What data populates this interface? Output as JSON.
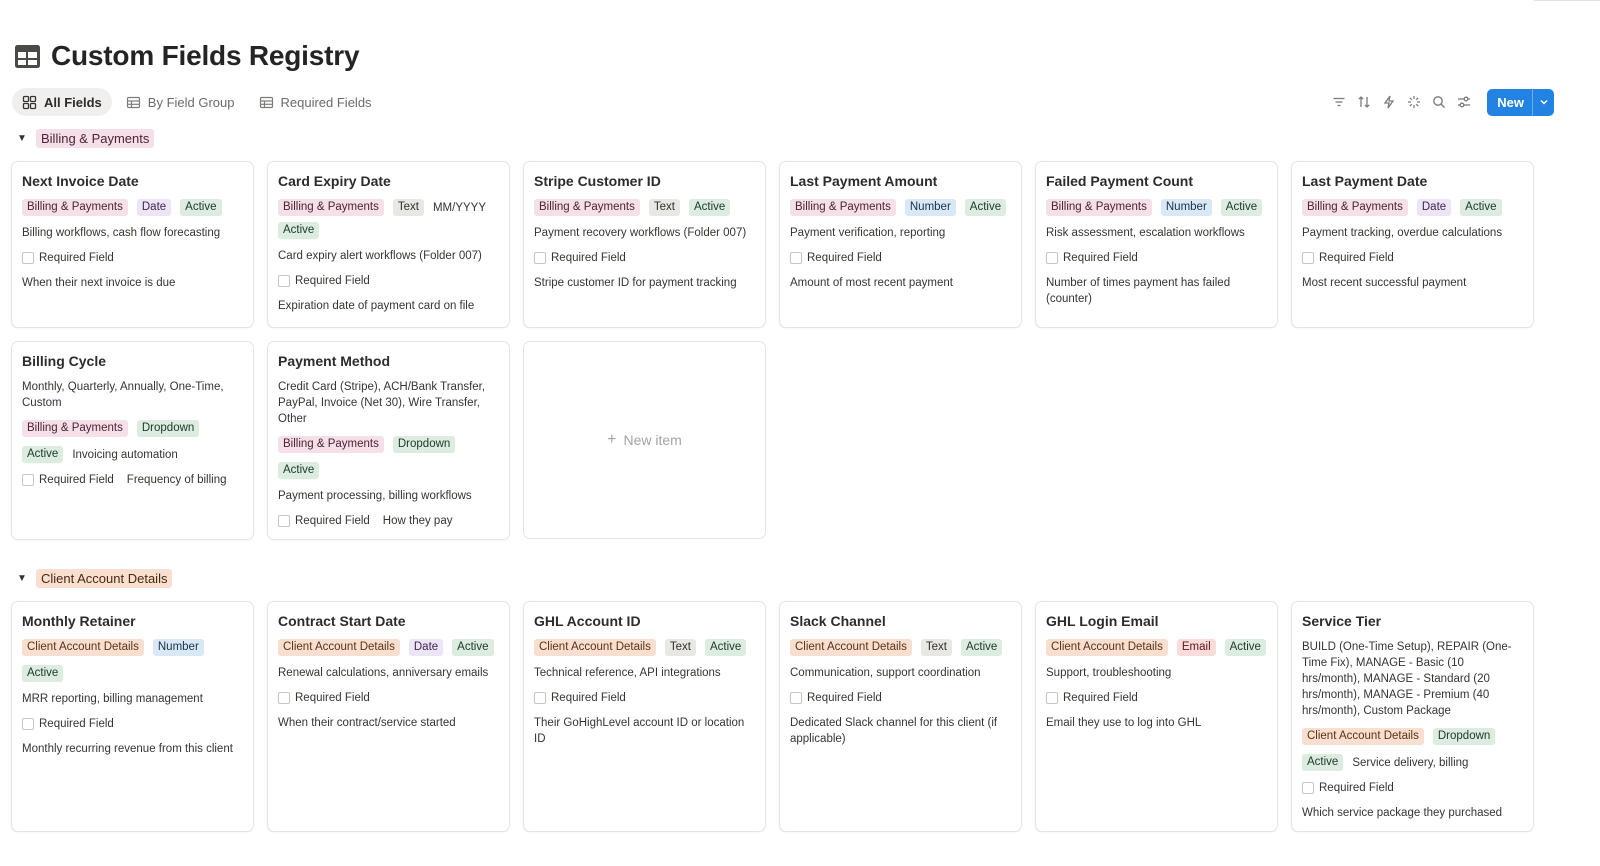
{
  "page": {
    "title": "Custom Fields Registry"
  },
  "views": {
    "tabs": [
      {
        "label": "All Fields"
      },
      {
        "label": "By Field Group"
      },
      {
        "label": "Required Fields"
      }
    ],
    "new_label": "New"
  },
  "groups": [
    {
      "name": "Billing & Payments"
    },
    {
      "name": "Client Account Details"
    }
  ],
  "labels": {
    "required": "Required Field",
    "new_item": "New item"
  },
  "cards": [
    {
      "title": "Next Invoice Date",
      "group": "Billing & Payments",
      "type": "Date",
      "status": "Active",
      "usage": "Billing workflows, cash flow forecasting",
      "description": "When their next invoice is due"
    },
    {
      "title": "Card Expiry Date",
      "group": "Billing & Payments",
      "type": "Text",
      "format": "MM/YYYY",
      "status": "Active",
      "usage": "Card expiry alert workflows (Folder 007)",
      "description": "Expiration date of payment card on file"
    },
    {
      "title": "Stripe Customer ID",
      "group": "Billing & Payments",
      "type": "Text",
      "status": "Active",
      "usage": "Payment recovery workflows (Folder 007)",
      "description": "Stripe customer ID for payment tracking"
    },
    {
      "title": "Last Payment Amount",
      "group": "Billing & Payments",
      "type": "Number",
      "status": "Active",
      "usage": "Payment verification, reporting",
      "description": "Amount of most recent payment"
    },
    {
      "title": "Failed Payment Count",
      "group": "Billing & Payments",
      "type": "Number",
      "status": "Active",
      "usage": "Risk assessment, escalation workflows",
      "description": "Number of times payment has failed (counter)"
    },
    {
      "title": "Last Payment Date",
      "group": "Billing & Payments",
      "type": "Date",
      "status": "Active",
      "usage": "Payment tracking, overdue calculations",
      "description": "Most recent successful payment"
    },
    {
      "title": "Billing Cycle",
      "options": "Monthly, Quarterly, Annually, One-Time, Custom",
      "group": "Billing & Payments",
      "type": "Dropdown",
      "status": "Active",
      "usage": "Invoicing automation",
      "description": "Frequency of billing"
    },
    {
      "title": "Payment Method",
      "options": "Credit Card (Stripe), ACH/Bank Transfer, PayPal, Invoice (Net 30), Wire Transfer, Other",
      "group": "Billing & Payments",
      "type": "Dropdown",
      "status": "Active",
      "usage": "Payment processing, billing workflows",
      "description": "How they pay"
    },
    {
      "title": "Monthly Retainer",
      "group": "Client Account Details",
      "type": "Number",
      "status": "Active",
      "usage": "MRR reporting, billing management",
      "description": "Monthly recurring revenue from this client"
    },
    {
      "title": "Contract Start Date",
      "group": "Client Account Details",
      "type": "Date",
      "status": "Active",
      "usage": "Renewal calculations, anniversary emails",
      "description": "When their contract/service started"
    },
    {
      "title": "GHL Account ID",
      "group": "Client Account Details",
      "type": "Text",
      "status": "Active",
      "usage": "Technical reference, API integrations",
      "description": "Their GoHighLevel account ID or location ID"
    },
    {
      "title": "Slack Channel",
      "group": "Client Account Details",
      "type": "Text",
      "status": "Active",
      "usage": "Communication, support coordination",
      "description": "Dedicated Slack channel for this client (if applicable)"
    },
    {
      "title": "GHL Login Email",
      "group": "Client Account Details",
      "type": "Email",
      "status": "Active",
      "usage": "Support, troubleshooting",
      "description": "Email they use to log into GHL"
    },
    {
      "title": "Service Tier",
      "options": "BUILD (One-Time Setup), REPAIR (One-Time Fix), MANAGE - Basic (10 hrs/month), MANAGE - Standard (20 hrs/month), MANAGE - Premium (40 hrs/month), Custom Package",
      "group": "Client Account Details",
      "type": "Dropdown",
      "status": "Active",
      "usage": "Service delivery, billing",
      "description": "Which service package they purchased"
    }
  ]
}
